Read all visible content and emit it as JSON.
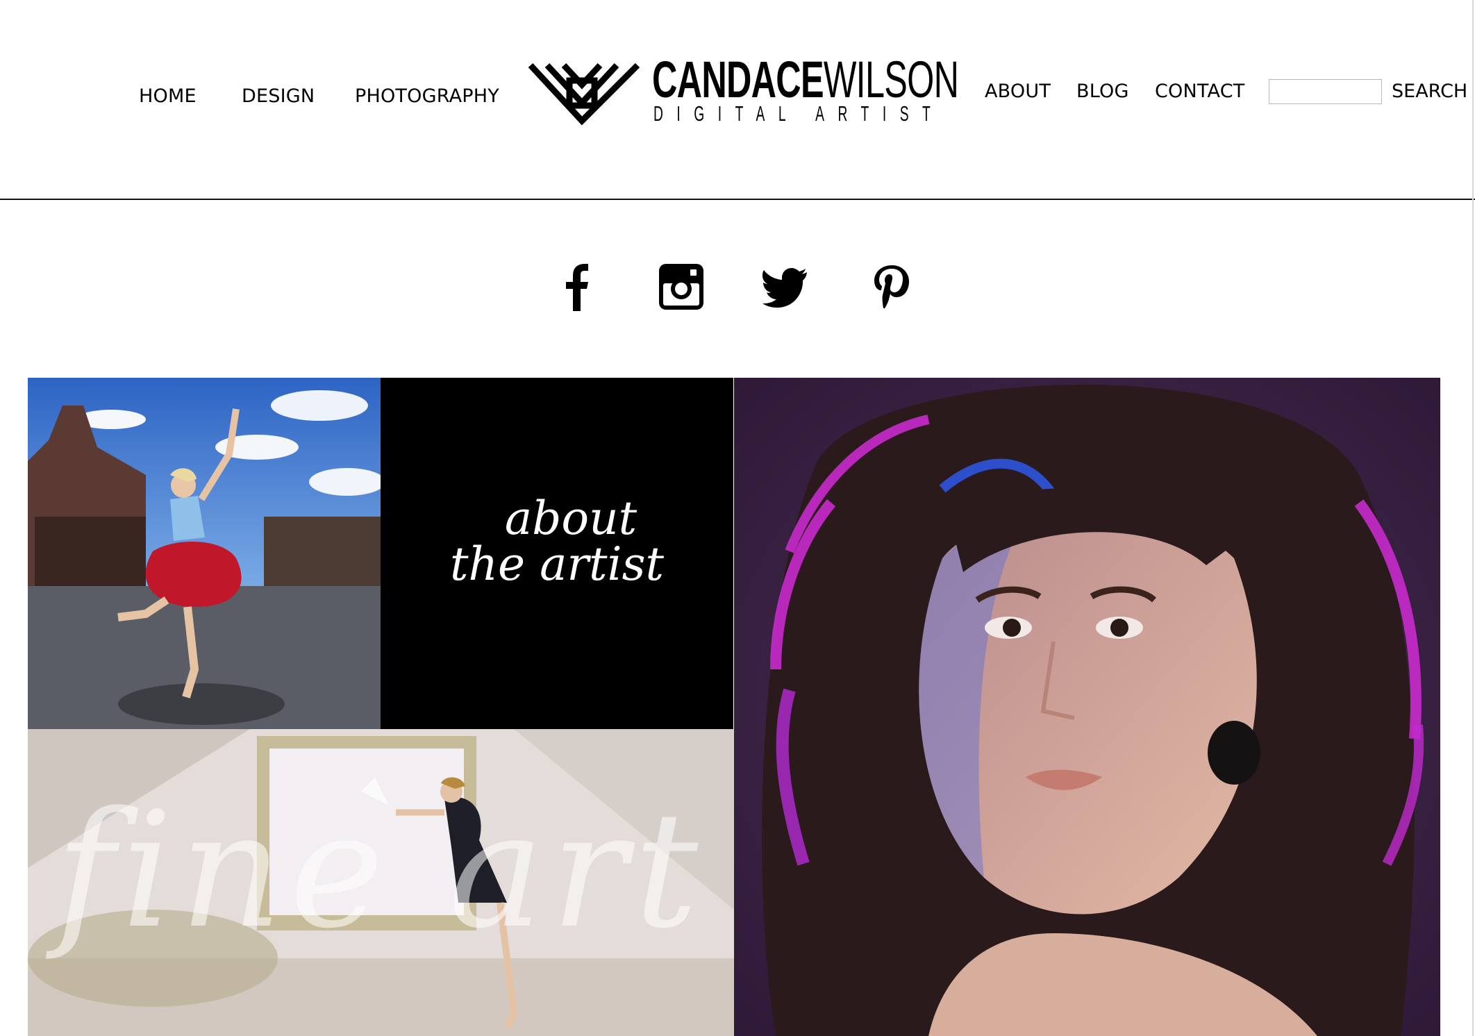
{
  "nav": {
    "home": "HOME",
    "design": "DESIGN",
    "photography": "PHOTOGRAPHY",
    "about": "ABOUT",
    "blog": "BLOG",
    "contact": "CONTACT"
  },
  "logo": {
    "name_bold": "CANDACE",
    "name_light": "WILSON",
    "tagline": "DIGITAL ARTIST"
  },
  "search": {
    "value": "",
    "button_label": "SEARCH"
  },
  "social": [
    "facebook-icon",
    "instagram-icon",
    "twitter-icon",
    "pinterest-icon"
  ],
  "gallery": {
    "about_line1": "about",
    "about_line2": "the artist",
    "fine_art": "fine art"
  },
  "colors": {
    "background": "#ffffff",
    "text": "#000000",
    "about_tile": "#000000",
    "portrait_magenta": "#d12bd6",
    "portrait_blue": "#2f55e0",
    "portrait_bg": "#3a1f44"
  }
}
